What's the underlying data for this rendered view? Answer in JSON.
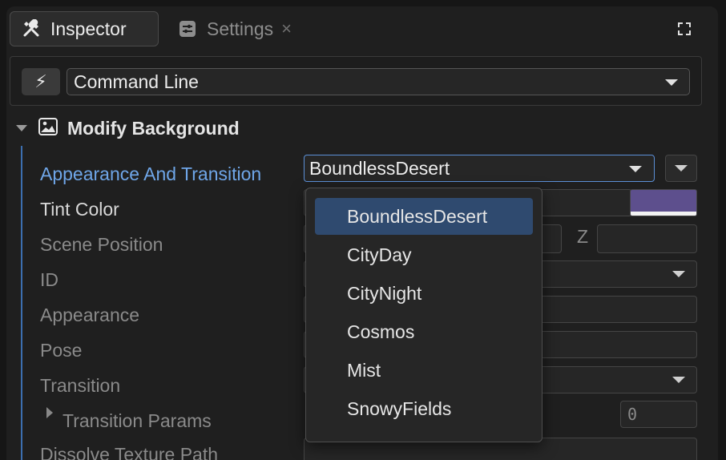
{
  "tabs": {
    "inspector_label": "Inspector",
    "settings_label": "Settings",
    "settings_close": "×"
  },
  "command": {
    "selected": "Command Line",
    "bolt_glyph": "⚡"
  },
  "section": {
    "title": "Modify Background"
  },
  "properties": {
    "appearance_transition_label": "Appearance And Transition",
    "appearance_transition_value": "BoundlessDesert",
    "tint_color_label": "Tint Color",
    "scene_position_label": "Scene Position",
    "z_label": "Z",
    "id_label": "ID",
    "appearance_label": "Appearance",
    "pose_label": "Pose",
    "transition_label": "Transition",
    "transition_params_label": "Transition Params",
    "transition_params_value": "0",
    "dissolve_texture_path_label": "Dissolve Texture Path"
  },
  "dropdown": {
    "options": [
      "BoundlessDesert",
      "CityDay",
      "CityNight",
      "Cosmos",
      "Mist",
      "SnowyFields"
    ],
    "selected_index": 0
  },
  "colors": {
    "accent": "#5b8fd6",
    "tint_swatch": "#5d4f8d",
    "selected_option_bg": "#2f4a6f"
  },
  "icons": {
    "inspector": "tools-icon",
    "settings": "sliders-icon",
    "bolt": "lightning-icon",
    "section": "image-icon",
    "expand": "fullscreen-icon"
  }
}
